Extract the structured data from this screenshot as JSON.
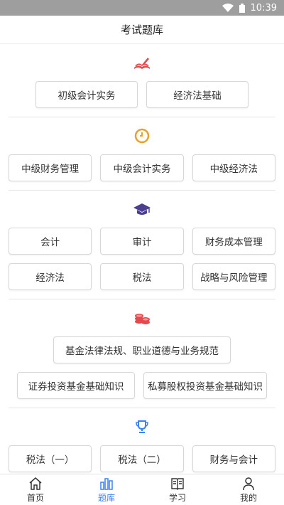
{
  "status": {
    "time": "10:39"
  },
  "header": {
    "title": "考试题库"
  },
  "sections": [
    {
      "icon": "book-pen-icon",
      "rows": [
        [
          "初级会计实务",
          "经济法基础"
        ]
      ]
    },
    {
      "icon": "clock-icon",
      "rows": [
        [
          "中级财务管理",
          "中级会计实务",
          "中级经济法"
        ]
      ]
    },
    {
      "icon": "graduation-cap-icon",
      "rows": [
        [
          "会计",
          "审计",
          "财务成本管理"
        ],
        [
          "经济法",
          "税法",
          "战略与风险管理"
        ]
      ]
    },
    {
      "icon": "coins-icon",
      "rows": [
        [
          "基金法律法规、职业道德与业务规范"
        ],
        [
          "证券投资基金基础知识",
          "私募股权投资基金基础知识"
        ]
      ]
    },
    {
      "icon": "trophy-icon",
      "rows": [
        [
          "税法（一）",
          "税法（二）",
          "财务与会计"
        ]
      ]
    }
  ],
  "tabs": [
    {
      "label": "首页",
      "icon": "home-icon",
      "active": false
    },
    {
      "label": "题库",
      "icon": "question-bank-icon",
      "active": true
    },
    {
      "label": "学习",
      "icon": "book-icon",
      "active": false
    },
    {
      "label": "我的",
      "icon": "user-icon",
      "active": false
    }
  ],
  "colors": {
    "accent": "#3b82f6",
    "red": "#e5484d",
    "gold": "#e9a12a",
    "purple": "#4b3d8f"
  }
}
